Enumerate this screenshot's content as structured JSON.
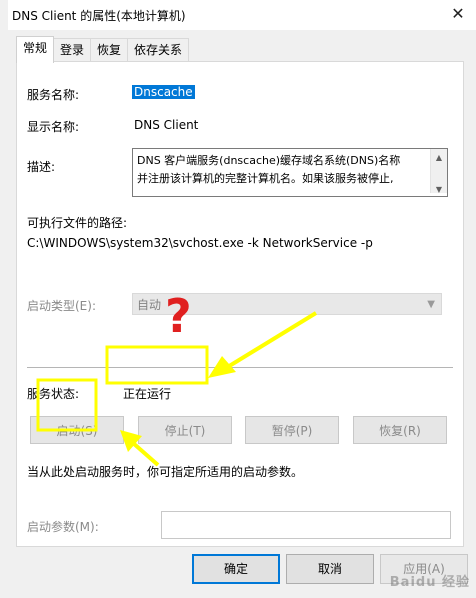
{
  "window": {
    "title": "DNS Client 的属性(本地计算机)",
    "close_glyph": "✕"
  },
  "tabs": [
    {
      "label": "常规",
      "active": true
    },
    {
      "label": "登录",
      "active": false
    },
    {
      "label": "恢复",
      "active": false
    },
    {
      "label": "依存关系",
      "active": false
    }
  ],
  "general": {
    "service_name_label": "服务名称:",
    "service_name_value": "Dnscache",
    "display_name_label": "显示名称:",
    "display_name_value": "DNS Client",
    "description_label": "描述:",
    "description_line1": "DNS 客户端服务(dnscache)缓存域名系统(DNS)名称",
    "description_line2": "并注册该计算机的完整计算机名。如果该服务被停止,",
    "path_label": "可执行文件的路径:",
    "path_value": "C:\\WINDOWS\\system32\\svchost.exe -k NetworkService -p",
    "startup_type_label": "启动类型(E):",
    "startup_type_value": "自动",
    "service_status_label": "服务状态:",
    "service_status_value": "正在运行",
    "buttons": {
      "start": "启动(S)",
      "stop": "停止(T)",
      "pause": "暂停(P)",
      "resume": "恢复(R)"
    },
    "hint": "当从此处启动服务时，你可指定所适用的启动参数。",
    "params_label": "启动参数(M):",
    "params_value": ""
  },
  "footer": {
    "ok": "确定",
    "cancel": "取消",
    "apply": "应用(A)"
  },
  "annotation": {
    "question_mark": "?",
    "color": "#ffff00",
    "question_color": "#e02020"
  },
  "watermark": "Baidu 经验",
  "colors": {
    "selection": "#0078d7",
    "dialog_bg": "#f0f0f0"
  }
}
